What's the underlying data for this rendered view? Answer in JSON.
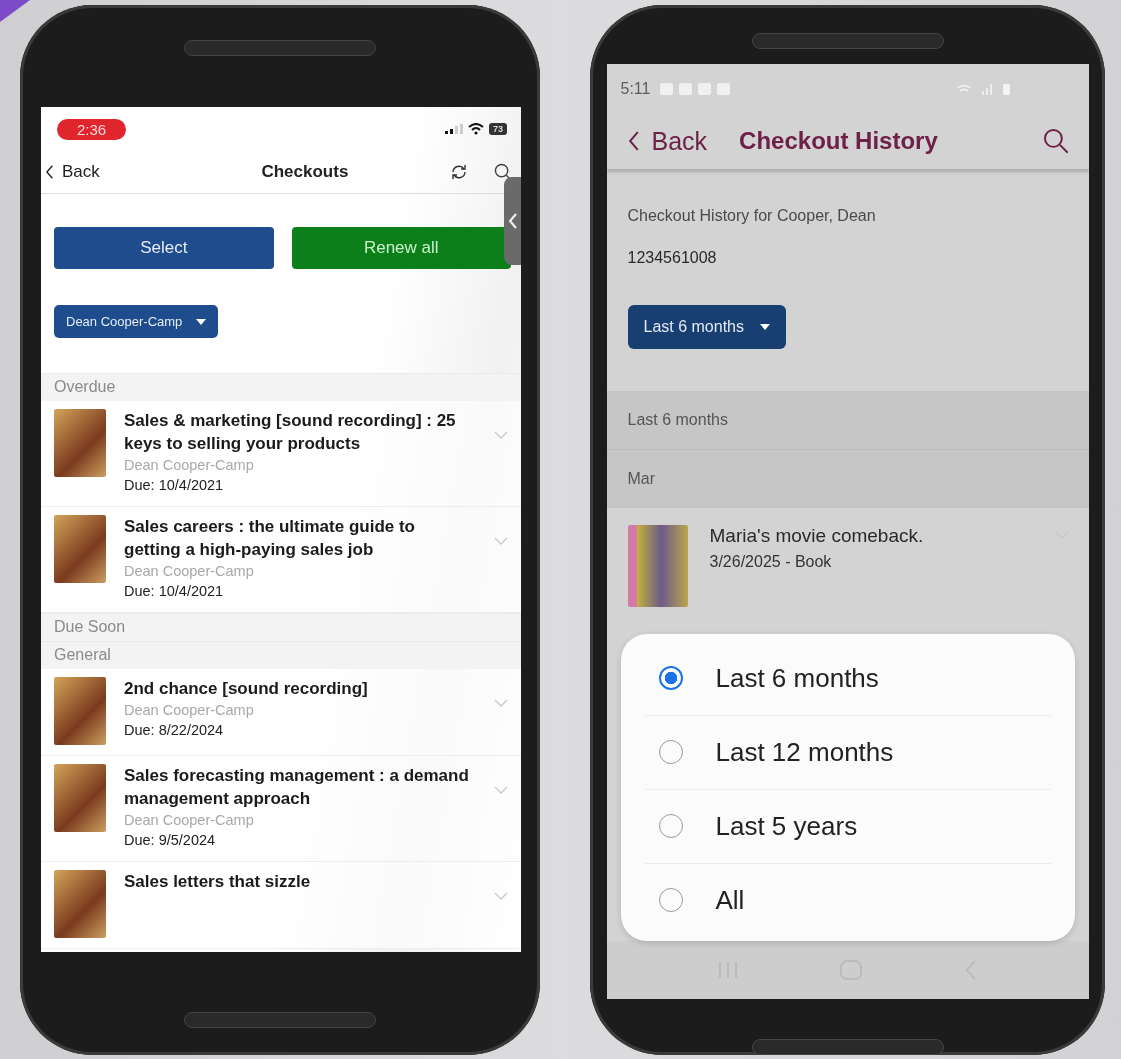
{
  "left_phone": {
    "status_bar": {
      "time": "2:36",
      "battery": "73"
    },
    "nav": {
      "back": "Back",
      "title": "Checkouts"
    },
    "buttons": [
      {
        "label": "Select",
        "kind": "primary"
      },
      {
        "label": "Renew all",
        "kind": "success"
      }
    ],
    "patron_dropdown": "Dean Cooper-Camp",
    "sections": [
      {
        "title": "Overdue",
        "items": [
          {
            "title": "Sales & marketing [sound recording] : 25 keys to selling your products",
            "patron": "Dean Cooper-Camp",
            "due": "Due: 10/4/2021"
          },
          {
            "title": "Sales careers : the ultimate guide to getting a high-paying sales job",
            "patron": "Dean Cooper-Camp",
            "due": "Due: 10/4/2021"
          }
        ]
      },
      {
        "title": "Due Soon"
      },
      {
        "title": "General",
        "items": [
          {
            "title": "2nd chance [sound recording]",
            "patron": "Dean Cooper-Camp",
            "due": "Due: 8/22/2024"
          },
          {
            "title": "Sales forecasting management : a demand management approach",
            "patron": "Dean Cooper-Camp",
            "due": "Due: 9/5/2024"
          },
          {
            "title": "Sales letters that sizzle"
          }
        ]
      }
    ]
  },
  "right_phone": {
    "status_bar": {
      "time": "5:11"
    },
    "nav": {
      "back": "Back",
      "title": "Checkout History"
    },
    "heading": "Checkout History for Cooper, Dean",
    "card_number": "1234561008",
    "period_dropdown": "Last 6 months",
    "group_header": "Last 6 months",
    "month": "Mar",
    "items": [
      {
        "title": "Maria's movie comeback.",
        "detail": "3/26/2025 - Book"
      }
    ],
    "period_options": [
      {
        "label": "Last 6 months",
        "selected": true
      },
      {
        "label": "Last 12 months",
        "selected": false
      },
      {
        "label": "Last 5 years",
        "selected": false
      },
      {
        "label": "All",
        "selected": false
      }
    ]
  }
}
